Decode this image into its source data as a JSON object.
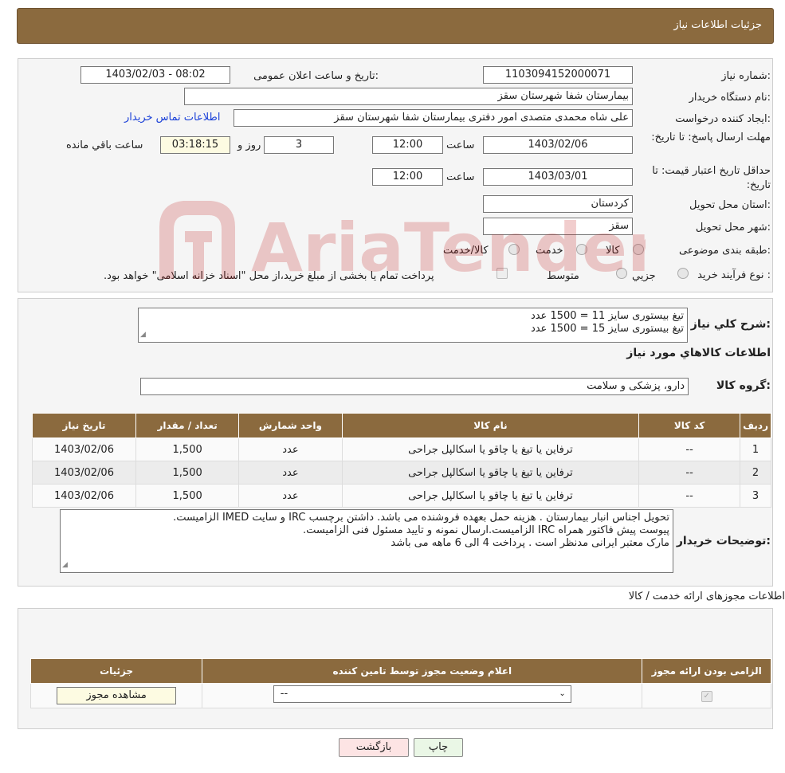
{
  "header": {
    "title": "جزئیات اطلاعات نیاز"
  },
  "info": {
    "need_number_label": "شماره نیاز:",
    "need_number": "1103094152000071",
    "announce_label": "تاریخ و ساعت اعلان عمومی:",
    "announce_value": "1403/02/03 - 08:02",
    "buyer_org_label": "نام دستگاه خریدار:",
    "buyer_org": "بیمارستان شفا شهرستان سقز",
    "requester_label": "ایجاد کننده درخواست:",
    "requester": "علی شاه محمدی متصدی امور دفتری بیمارستان شفا شهرستان سقز",
    "contact_link": "اطلاعات تماس خریدار",
    "deadline_label": "مهلت ارسال پاسخ: تا تاریخ:",
    "deadline_date": "1403/02/06",
    "time_label": "ساعت",
    "deadline_time": "12:00",
    "days_value": "3",
    "days_label": "روز و",
    "remaining_value": "03:18:15",
    "remaining_label": "ساعت باقي مانده",
    "validity_label": "حداقل تاریخ اعتبار قیمت: تا تاریخ:",
    "validity_date": "1403/03/01",
    "validity_time": "12:00",
    "province_label": "استان محل تحویل:",
    "province": "کردستان",
    "city_label": "شهر محل تحویل:",
    "city": "سقز",
    "category_label": "طبقه بندی موضوعی:",
    "category_options": [
      "کالا",
      "خدمت",
      "کالا/خدمت"
    ],
    "process_label": "نوع فرآیند خرید :",
    "process_options": [
      "جزیي",
      "متوسط"
    ],
    "process_note": "پرداخت تمام یا بخشی از مبلغ خرید،از محل \"اسناد خزانه اسلامی\" خواهد بود."
  },
  "summary": {
    "label": "شرح كلي نياز:",
    "lines": [
      "تیغ بیستوری سایز 11 = 1500 عدد",
      "تیغ بیستوری سایز 15 = 1500 عدد"
    ],
    "goods_info_title": "اطلاعات كالاهاي مورد نياز",
    "group_label": "گروه کالا:",
    "group_value": "دارو، پزشکی و سلامت"
  },
  "goods_table": {
    "headers": [
      "ردیف",
      "کد کالا",
      "نام کالا",
      "واحد شمارش",
      "تعداد / مقدار",
      "تاریخ نیاز"
    ],
    "rows": [
      [
        "1",
        "--",
        "ترفاین یا تیغ یا چاقو یا اسکالپل جراحی",
        "عدد",
        "1,500",
        "1403/02/06"
      ],
      [
        "2",
        "--",
        "ترفاین یا تیغ یا چاقو یا اسکالپل جراحی",
        "عدد",
        "1,500",
        "1403/02/06"
      ],
      [
        "3",
        "--",
        "ترفاین یا تیغ یا چاقو یا اسکالپل جراحی",
        "عدد",
        "1,500",
        "1403/02/06"
      ]
    ]
  },
  "buyer_notes": {
    "label": "توضیحات خریدار:",
    "lines": [
      "تحویل اجناس  انبار بیمارستان . هزینه حمل بعهده فروشنده می باشد.  داشتن برچسب IRC  و سایت  IMED  الزامیست.",
      "پیوست پیش فاکتور همراه IRC  الزامیست.ارسال نمونه و تایید مسئول فنی الزامیست.",
      "مارک معتبر ایرانی مدنظر است . پرداخت 4 الی 6 ماهه می باشد"
    ]
  },
  "permits": {
    "title": "اطلاعات مجوزهای ارائه خدمت / کالا",
    "headers": [
      "الزامی بودن ارائه مجوز",
      "اعلام وضعیت مجوز توسط تامین کننده",
      "جزئیات"
    ],
    "select_value": "--",
    "view_button": "مشاهده مجوز"
  },
  "actions": {
    "print": "چاپ",
    "back": "بازگشت"
  },
  "watermark": {
    "text": "AriaTender.neT"
  }
}
